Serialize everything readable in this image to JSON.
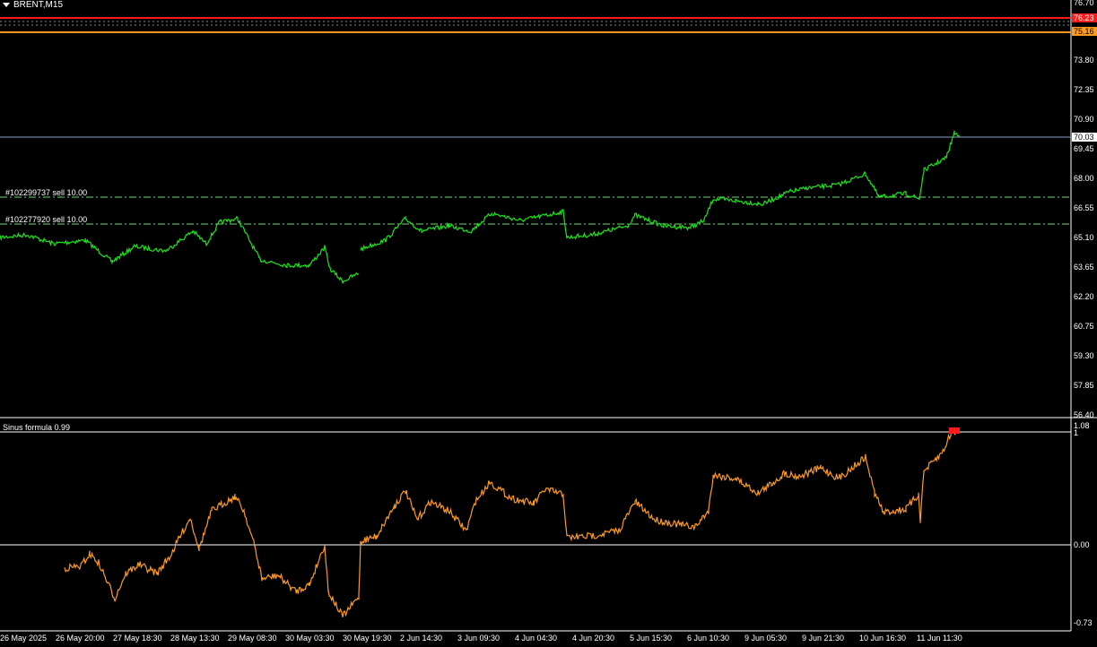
{
  "window": {
    "title": "BRENT,M15"
  },
  "indicator": {
    "title": "Sinus formula 0.99"
  },
  "orders": [
    {
      "label": "#102299737 sell 10.00"
    },
    {
      "label": "#102277920 sell 10.00"
    }
  ],
  "price_axis": [
    "76.70",
    "73.80",
    "72.35",
    "70.90",
    "69.45",
    "68.00",
    "66.55",
    "65.10",
    "63.65",
    "62.20",
    "60.75",
    "59.30",
    "57.85",
    "56.40"
  ],
  "price_tags": {
    "current": "70.03",
    "red": "76.23",
    "orange": "75.16"
  },
  "indicator_axis": {
    "top": "1.08",
    "top2": "1",
    "zero": "0.00",
    "bottom": "-0.73"
  },
  "time_axis": [
    "26 May 2025",
    "26 May 20:00",
    "27 May 18:30",
    "28 May 13:30",
    "29 May 08:30",
    "30 May 03:30",
    "30 May 19:30",
    "2 Jun 14:30",
    "3 Jun 09:30",
    "4 Jun 04:30",
    "4 Jun 20:30",
    "5 Jun 15:30",
    "6 Jun 10:30",
    "9 Jun 05:30",
    "9 Jun 21:30",
    "10 Jun 16:30",
    "11 Jun 11:30"
  ],
  "colors": {
    "price_line": "#19e619",
    "indicator_line": "#ff9a1f",
    "red_level": "#ff1a1a",
    "orange_level": "#ff9a1f",
    "order_line": "#6fd86f"
  }
}
